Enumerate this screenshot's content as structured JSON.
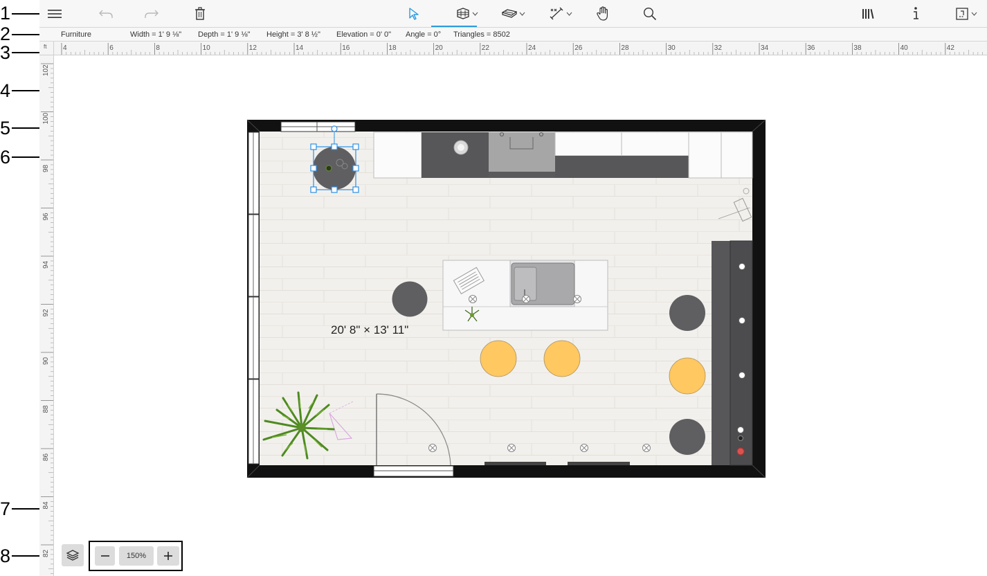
{
  "callouts": [
    "1",
    "2",
    "3",
    "4",
    "5",
    "6",
    "7",
    "8"
  ],
  "toolbar": {
    "menu_icon": "hamburger-menu-icon",
    "undo_icon": "undo-icon",
    "redo_icon": "redo-icon",
    "delete_icon": "trash-icon",
    "select_icon": "pointer-arrow-icon",
    "wall_icon": "wall-brick-icon",
    "floor_icon": "floor-tile-icon",
    "dimension_icon": "dimension-tool-icon",
    "pan_icon": "hand-icon",
    "zoom_icon": "magnifier-icon",
    "library_icon": "library-books-icon",
    "info_icon": "info-icon",
    "export_icon": "export-view-icon",
    "accent_color": "#2a9be0"
  },
  "info_bar": {
    "category": "Furniture",
    "width": "Width = 1' 9 ⅛\"",
    "depth": "Depth = 1' 9 ⅛\"",
    "height": "Height = 3' 8 ½\"",
    "elevation": "Elevation = 0' 0\"",
    "angle": "Angle = 0°",
    "triangles": "Triangles = 8502"
  },
  "ruler": {
    "unit": "ft",
    "horizontal_labels": [
      "4",
      "6",
      "8",
      "10",
      "12",
      "14",
      "16",
      "18",
      "20",
      "22",
      "24",
      "26",
      "28",
      "30",
      "32",
      "34",
      "36",
      "38",
      "40",
      "42"
    ],
    "vertical_labels": [
      "102",
      "100",
      "98",
      "96",
      "94",
      "92",
      "90",
      "88",
      "86",
      "84",
      "82"
    ]
  },
  "plan": {
    "room_dimensions": "20' 8\" × 13' 11\"",
    "floor_color": "#f0eeea",
    "wall_color": "#111111",
    "stool_color": "#ffc861",
    "dark_stool_color": "#5f5f62",
    "selection_color": "#2a8fe6"
  },
  "bottom_controls": {
    "layers_icon": "layers-icon",
    "zoom_out_icon": "minus-icon",
    "zoom_level": "150%",
    "zoom_in_icon": "plus-icon"
  }
}
